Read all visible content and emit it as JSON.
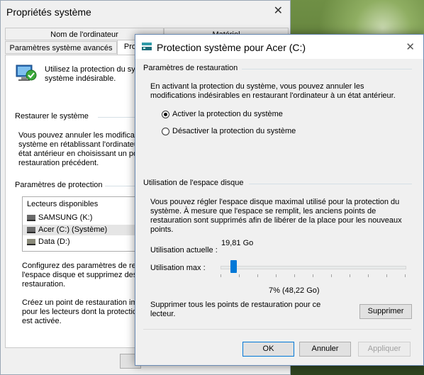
{
  "back_window": {
    "title": "Propriétés système",
    "tabs_row1": [
      "Nom de l'ordinateur",
      "Matériel"
    ],
    "tabs_row2": [
      "Paramètres système avancés",
      "Protection du système"
    ],
    "tab_partial": "Prot",
    "intro_line1": "Utilisez la protection du sys",
    "intro_line2": "système indésirable.",
    "restore_group": "Restaurer le système",
    "restore_text": [
      "Vous pouvez annuler les modificati",
      "système en rétablissant l'ordinateur",
      "état antérieur en choisissant un poin",
      "restauration précédent."
    ],
    "protection_group": "Paramètres de protection",
    "list_header": "Lecteurs disponibles",
    "drives": [
      "SAMSUNG (K:)",
      "Acer (C:) (Système)",
      "Data (D:)"
    ],
    "config_text": [
      "Configurez des paramètres de resta",
      "l'espace disque et supprimez des p",
      "restauration."
    ],
    "create_text": [
      "Créez un point de restauration imm",
      "pour les lecteurs dont la protection",
      "est activée."
    ]
  },
  "dialog": {
    "title": "Protection système pour Acer (C:)",
    "restore_section": "Paramètres de restauration",
    "restore_desc": [
      "En activant la protection du système, vous pouvez annuler les",
      "modifications indésirables en restaurant l'ordinateur à un état antérieur."
    ],
    "radio_on": "Activer la protection du système",
    "radio_off": "Désactiver la protection du système",
    "disk_section": "Utilisation de l'espace disque",
    "disk_desc": [
      "Vous pouvez régler l'espace disque maximal utilisé pour la protection du",
      "système. À mesure que l'espace se remplit, les anciens points de",
      "restauration sont supprimés afin de libérer de la place pour les nouveaux",
      "points."
    ],
    "current_label": "Utilisation actuelle :",
    "current_value": "19,81 Go",
    "max_label": "Utilisation max :",
    "max_value": "7% (48,22 Go)",
    "max_percent": 7,
    "delete_text": [
      "Supprimer tous les points de restauration pour ce",
      "lecteur."
    ],
    "delete_button": "Supprimer",
    "ok_button": "OK",
    "cancel_button": "Annuler",
    "apply_button": "Appliquer"
  }
}
